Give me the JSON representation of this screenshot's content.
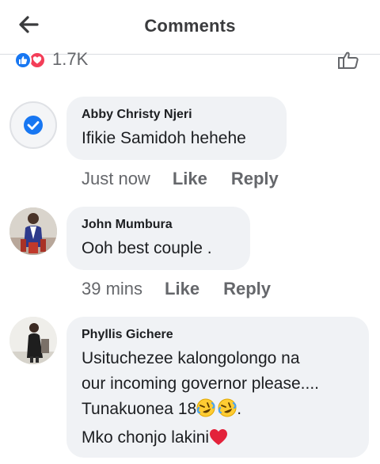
{
  "header": {
    "title": "Comments",
    "back_icon": "arrow-left-icon"
  },
  "reactions": {
    "count": "1.7K",
    "types": [
      "like",
      "love"
    ],
    "like_color": "#1877f2",
    "love_color": "#f33e58"
  },
  "comments": [
    {
      "author": "Abby Christy Njeri",
      "lines": [
        "Ifikie Samidoh hehehe"
      ],
      "time": "Just now",
      "like_label": "Like",
      "reply_label": "Reply",
      "avatar": "verified-badge-icon"
    },
    {
      "author": "John Mumbura",
      "lines": [
        "Ooh  best couple ."
      ],
      "time": "39 mins",
      "like_label": "Like",
      "reply_label": "Reply",
      "avatar": "photo-avatar"
    },
    {
      "author": "Phyllis Gichere",
      "lines": [
        "Usituchezee kalongolongo na",
        "our incoming governor please....",
        "Tunakuonea 18",
        ".",
        "Mko chonjo lakini"
      ],
      "emojis": [
        "rolling-laughing-emoji",
        "rolling-laughing-emoji",
        "red-heart-emoji"
      ],
      "avatar": "photo-avatar"
    }
  ],
  "colors": {
    "bubble": "#f0f2f5",
    "secondary_text": "#65676b",
    "verified_blue": "#1877f2"
  }
}
